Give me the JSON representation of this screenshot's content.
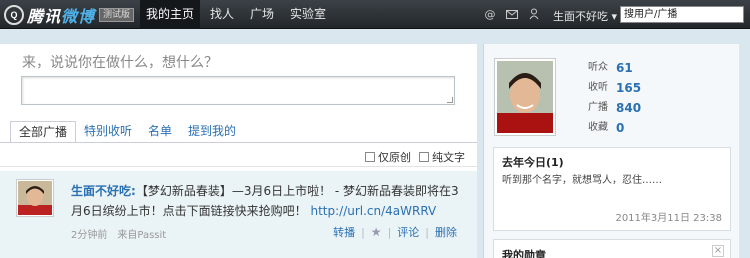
{
  "brand": {
    "mark": "Q",
    "name_part1": "腾讯",
    "name_part2": "微博",
    "badge": "测试版"
  },
  "nav": {
    "items": [
      "我的主页",
      "找人",
      "广场",
      "实验室"
    ]
  },
  "topbar": {
    "icons": [
      "at-icon",
      "mail-icon",
      "person-icon"
    ],
    "user_menu": "生面不好吃",
    "search_placeholder": "搜用户/广播"
  },
  "compose": {
    "prompt": "来，说说你在做什么，想什么？"
  },
  "tabs": [
    "全部广播",
    "特别收听",
    "名单",
    "提到我的"
  ],
  "filters": [
    "仅原创",
    "纯文字"
  ],
  "feed": [
    {
      "author": "生面不好吃:",
      "text": "【梦幻新品春装】—3月6日上市啦！ - 梦幻新品春装即将在3月6日缤纷上市！点击下面链接快来抢购吧！",
      "link": "http://url.cn/4aWRRV",
      "time": "2分钟前",
      "source": "来自Passit",
      "actions": {
        "forward": "转播",
        "comment": "评论",
        "delete": "删除"
      }
    }
  ],
  "profile": {
    "stats": [
      {
        "label": "听众",
        "value": "61"
      },
      {
        "label": "收听",
        "value": "165"
      },
      {
        "label": "广播",
        "value": "840"
      },
      {
        "label": "收藏",
        "value": "0"
      }
    ]
  },
  "history": {
    "title": "去年今日(1)",
    "text": "听到那个名字，就想骂人，忍住……",
    "date": "2011年3月11日 23:38"
  },
  "medals": {
    "title": "我的勋章",
    "close": "×"
  }
}
